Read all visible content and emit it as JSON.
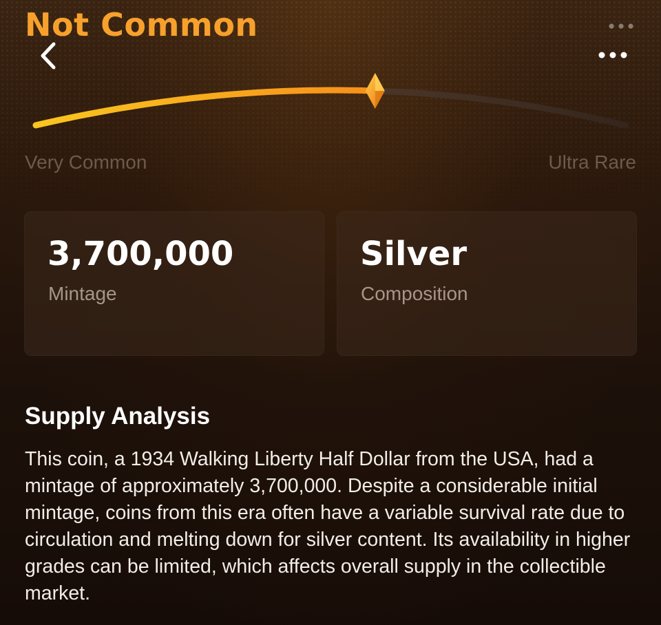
{
  "rarity": {
    "title": "Not Common",
    "level": 0.57,
    "scale_min_label": "Very Common",
    "scale_max_label": "Ultra Rare",
    "colors": {
      "title": "#f7a12c",
      "track_fill": "#f5a623",
      "track_empty": "#3a2b22",
      "marker": "#f39c12"
    }
  },
  "nav": {
    "back_icon": "chevron-left-icon",
    "more_icon": "more-horizontal-icon"
  },
  "stats": {
    "mintage": {
      "value": "3,700,000",
      "label": "Mintage"
    },
    "composition": {
      "value": "Silver",
      "label": "Composition"
    }
  },
  "supply_analysis": {
    "title": "Supply Analysis",
    "body": "This coin, a 1934 Walking Liberty Half Dollar from the USA, had a mintage of approximately 3,700,000. Despite a considerable initial mintage, coins from this era often have a variable survival rate due to circulation and melting down for silver content. Its availability in higher grades can be limited, which affects overall supply in the collectible market."
  }
}
